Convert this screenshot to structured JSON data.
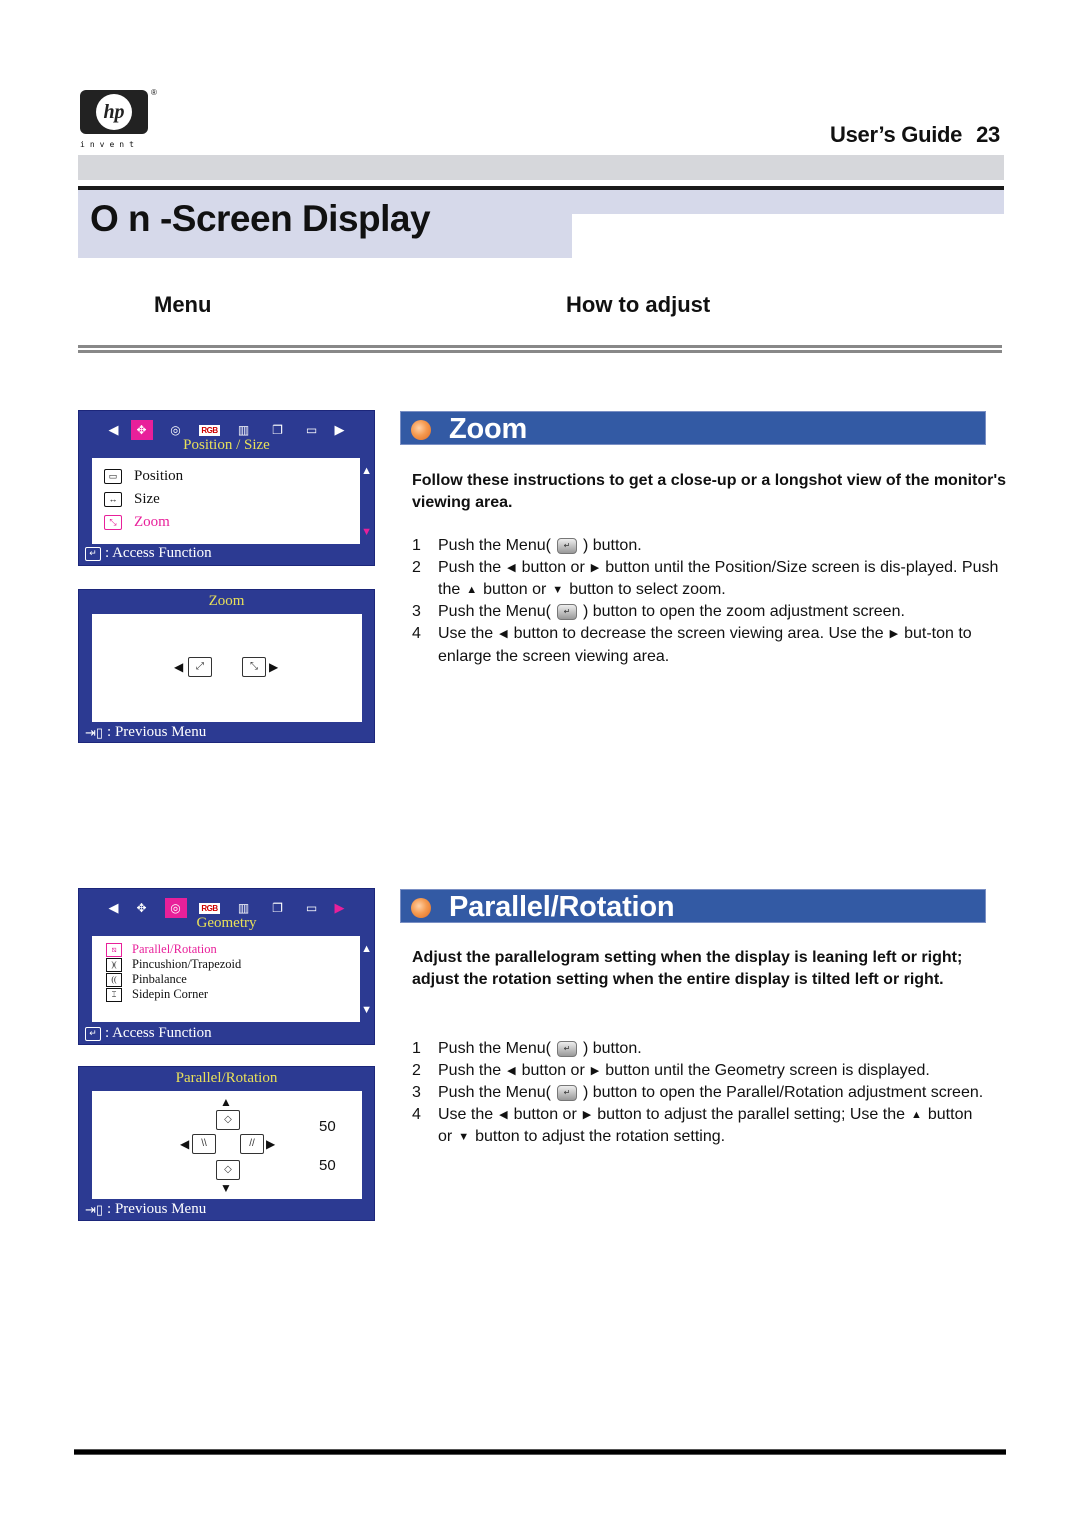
{
  "header": {
    "brand": "hp",
    "tagline": "invent",
    "registered": "®",
    "guide_label": "User’s Guide",
    "page_number": "23"
  },
  "page_title": "O n -Screen Display",
  "columns": {
    "menu": "Menu",
    "how": "How to adjust"
  },
  "osd_position_size": {
    "title": "Position / Size",
    "items": [
      {
        "label": "Position",
        "icon": "position-icon",
        "selected": false
      },
      {
        "label": "Size",
        "icon": "size-icon",
        "selected": false
      },
      {
        "label": "Zoom",
        "icon": "zoom-icon",
        "selected": true
      }
    ],
    "footer": ": Access Function",
    "rgb": "RGB"
  },
  "osd_zoom": {
    "title": "Zoom",
    "footer": ": Previous Menu"
  },
  "osd_geometry": {
    "title": "Geometry",
    "items": [
      {
        "label": "Parallel/Rotation",
        "selected": true
      },
      {
        "label": "Pincushion/Trapezoid",
        "selected": false
      },
      {
        "label": "Pinbalance",
        "selected": false
      },
      {
        "label": "Sidepin Corner",
        "selected": false
      }
    ],
    "footer": ": Access Function",
    "rgb": "RGB"
  },
  "osd_parallel": {
    "title": "Parallel/Rotation",
    "value_parallel": "50",
    "value_rotation": "50",
    "footer": ": Previous Menu"
  },
  "zoom_section": {
    "heading": "Zoom",
    "intro": "Follow these instructions to get a close-up or a longshot view of the monitor's viewing area.",
    "steps": [
      {
        "n": "1",
        "parts": [
          "Push the Menu(",
          ") button."
        ]
      },
      {
        "n": "2",
        "parts": [
          "Push the",
          "button or",
          "button until the Position/Size screen is dis-played. Push the",
          "button or",
          "button to select zoom."
        ]
      },
      {
        "n": "3",
        "parts": [
          "Push the Menu(",
          ") button to open the zoom adjustment screen."
        ]
      },
      {
        "n": "4",
        "parts": [
          "Use the",
          "button to decrease the screen viewing area. Use the",
          "but-ton to enlarge the screen viewing area."
        ]
      }
    ]
  },
  "parallel_section": {
    "heading": "Parallel/Rotation",
    "intro": "Adjust the parallelogram setting when the display is leaning left or right; adjust the rotation setting when the entire display is tilted left or right.",
    "steps": [
      {
        "n": "1",
        "parts": [
          "Push the Menu(",
          ") button."
        ]
      },
      {
        "n": "2",
        "parts": [
          "Push the",
          "button or",
          "button until the Geometry screen is displayed."
        ]
      },
      {
        "n": "3",
        "parts": [
          "Push the Menu(",
          ") button to open the Parallel/Rotation adjustment screen."
        ]
      },
      {
        "n": "4",
        "parts": [
          "Use the",
          "button or",
          "button to adjust the parallel setting; Use the",
          "button or",
          "button to adjust the rotation setting."
        ]
      }
    ]
  },
  "colors": {
    "osd_blue": "#2c3a92",
    "osd_highlight": "#e8209a",
    "osd_title": "#e8e05a",
    "section_blue": "#335aa4",
    "title_band": "#d6d9ea"
  }
}
